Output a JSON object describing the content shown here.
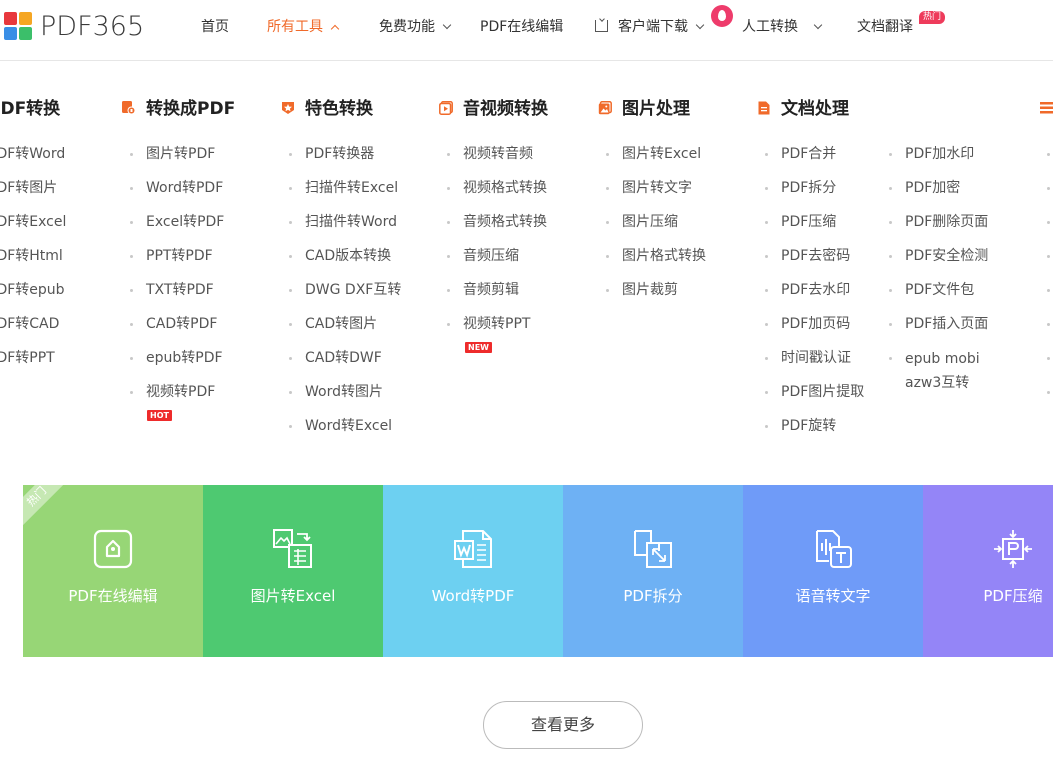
{
  "brand": {
    "name": "PDF365",
    "colors": {
      "red": "#e8383d",
      "orange": "#f5a623",
      "blue": "#3a8ee6",
      "green": "#3bbf6a"
    }
  },
  "nav": {
    "home": "首页",
    "all_tools": "所有工具",
    "free_features": "免费功能",
    "online_edit": "PDF在线编辑",
    "client_download": "客户端下载",
    "human_convert": "人工转换",
    "doc_translate": "文档翻译",
    "hot_badge": "热门",
    "active_color": "#f06a2a"
  },
  "menu": {
    "col1": {
      "title": "PDF转换",
      "items": [
        "PDF转Word",
        "PDF转图片",
        "PDF转Excel",
        "PDF转Html",
        "PDF转epub",
        "PDF转CAD",
        "PDF转PPT"
      ]
    },
    "col2": {
      "title": "转换成PDF",
      "icon": "convert-to-pdf-icon",
      "items": [
        "图片转PDF",
        "Word转PDF",
        "Excel转PDF",
        "PPT转PDF",
        "TXT转PDF",
        "CAD转PDF",
        "epub转PDF",
        "视频转PDF"
      ],
      "tag": "HOT"
    },
    "col3": {
      "title": "特色转换",
      "icon": "star-badge-icon",
      "items": [
        "PDF转换器",
        "扫描件转Excel",
        "扫描件转Word",
        "CAD版本转换",
        "DWG DXF互转",
        "CAD转图片",
        "CAD转DWF",
        "Word转图片",
        "Word转Excel"
      ]
    },
    "col4": {
      "title": "音视频转换",
      "icon": "video-play-icon",
      "items": [
        "视频转音频",
        "视频格式转换",
        "音频格式转换",
        "音频压缩",
        "音频剪辑",
        "视频转PPT"
      ],
      "tag": "NEW"
    },
    "col5": {
      "title": "图片处理",
      "icon": "image-icon",
      "items": [
        "图片转Excel",
        "图片转文字",
        "图片压缩",
        "图片格式转换",
        "图片裁剪"
      ]
    },
    "col6": {
      "title": "文档处理",
      "icon": "document-icon",
      "items_a": [
        "PDF合并",
        "PDF拆分",
        "PDF压缩",
        "PDF去密码",
        "PDF去水印",
        "PDF加页码",
        "时间戳认证",
        "PDF图片提取",
        "PDF旋转"
      ],
      "items_b": [
        "PDF加水印",
        "PDF加密",
        "PDF删除页面",
        "PDF安全检测",
        "PDF文件包",
        "PDF插入页面"
      ],
      "items_b_last": [
        "epub mobi",
        "azw3互转"
      ]
    },
    "accent": "#f06a2a"
  },
  "tiles": [
    {
      "label": "PDF在线编辑",
      "icon": "online-edit-icon",
      "color": "#97d676",
      "ribbon": "热门"
    },
    {
      "label": "图片转Excel",
      "icon": "image-to-excel-icon",
      "color": "#4ec971"
    },
    {
      "label": "Word转PDF",
      "icon": "word-to-pdf-icon",
      "color": "#6dd0f1"
    },
    {
      "label": "PDF拆分",
      "icon": "pdf-split-icon",
      "color": "#6eb1f4"
    },
    {
      "label": "语音转文字",
      "icon": "speech-to-text-icon",
      "color": "#6f9bf8"
    },
    {
      "label": "PDF压缩",
      "icon": "pdf-compress-icon",
      "color": "#9485f7"
    }
  ],
  "more_button": "查看更多"
}
